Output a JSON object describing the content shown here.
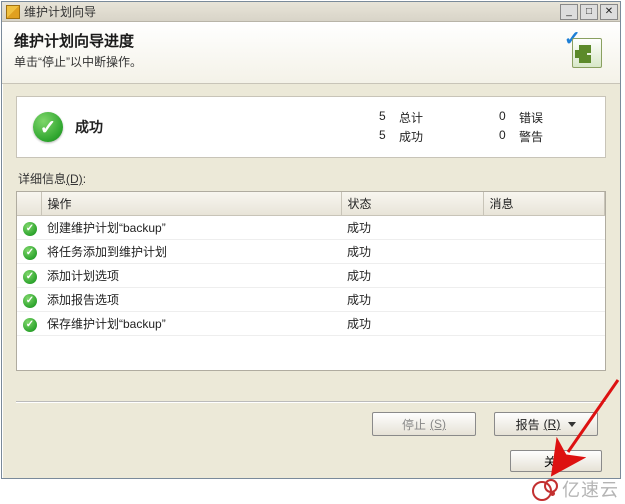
{
  "window": {
    "title": "维护计划向导"
  },
  "header": {
    "title": "维护计划向导进度",
    "subtitle": "单击“停止”以中断操作。"
  },
  "summary": {
    "status_label": "成功",
    "total_count": "5",
    "total_label": "总计",
    "success_count": "5",
    "success_label": "成功",
    "error_count": "0",
    "error_label": "错误",
    "warning_count": "0",
    "warning_label": "警告"
  },
  "details_label": {
    "text": "详细信息",
    "accel": "(D)",
    "suffix": ":"
  },
  "columns": {
    "action": "操作",
    "status": "状态",
    "message": "消息"
  },
  "rows": [
    {
      "action": "创建维护计划“backup”",
      "status": "成功",
      "message": ""
    },
    {
      "action": "将任务添加到维护计划",
      "status": "成功",
      "message": ""
    },
    {
      "action": "添加计划选项",
      "status": "成功",
      "message": ""
    },
    {
      "action": "添加报告选项",
      "status": "成功",
      "message": ""
    },
    {
      "action": "保存维护计划“backup”",
      "status": "成功",
      "message": ""
    }
  ],
  "buttons": {
    "stop": {
      "label": "停止",
      "accel": "(S)"
    },
    "report": {
      "label": "报告",
      "accel": "(R)"
    },
    "close": {
      "label": "关闭"
    }
  },
  "watermark": {
    "text": "亿速云"
  }
}
